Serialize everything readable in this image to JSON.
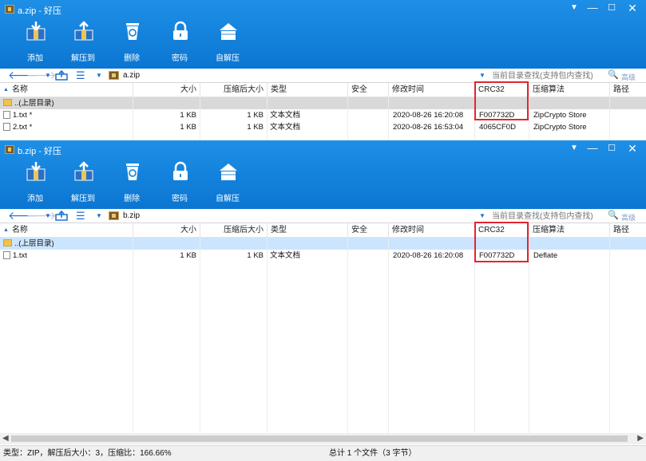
{
  "colors": {
    "titlebar": "#0b76d2",
    "highlight_box": "#e0262f",
    "selected_blue": "#cce5ff",
    "selected_gray": "#d9d9d9"
  },
  "toolbar": {
    "add": "添加",
    "extract_to": "解压到",
    "delete": "删除",
    "password": "密码",
    "self_extract": "自解压"
  },
  "search": {
    "placeholder": "当前目录查找(支持包内查找)",
    "advanced": "高级"
  },
  "columns": {
    "name": "名称",
    "size": "大小",
    "packed": "压缩后大小",
    "type": "类型",
    "security": "安全",
    "modified": "修改时间",
    "crc": "CRC32",
    "method": "压缩算法",
    "path": "路径"
  },
  "window_a": {
    "title": "a.zip - 好压",
    "path": "a.zip",
    "parent_dir": "..(上层目录)",
    "rows": [
      {
        "name": "1.txt *",
        "size": "1 KB",
        "packed": "1 KB",
        "type": "文本文档",
        "modified": "2020-08-26 16:20:08",
        "crc": "F007732D",
        "method": "ZipCrypto Store"
      },
      {
        "name": "2.txt *",
        "size": "1 KB",
        "packed": "1 KB",
        "type": "文本文档",
        "modified": "2020-08-26 16:53:04",
        "crc": "4065CF0D",
        "method": "ZipCrypto Store"
      }
    ]
  },
  "window_b": {
    "title": "b.zip - 好压",
    "path": "b.zip",
    "parent_dir": "..(上层目录)",
    "rows": [
      {
        "name": "1.txt",
        "size": "1 KB",
        "packed": "1 KB",
        "type": "文本文档",
        "modified": "2020-08-26 16:20:08",
        "crc": "F007732D",
        "method": "Deflate"
      }
    ],
    "status_left": "类型：ZIP，解压后大小：3，压缩比：166.66%",
    "status_mid": "总计 1 个文件（3 字节）"
  },
  "icons": {
    "title": "zip-archive-icon",
    "add": "archive-add-icon",
    "extract": "extract-icon",
    "delete": "recycle-bin-icon",
    "password": "lock-icon",
    "self_extract": "self-extract-icon"
  }
}
